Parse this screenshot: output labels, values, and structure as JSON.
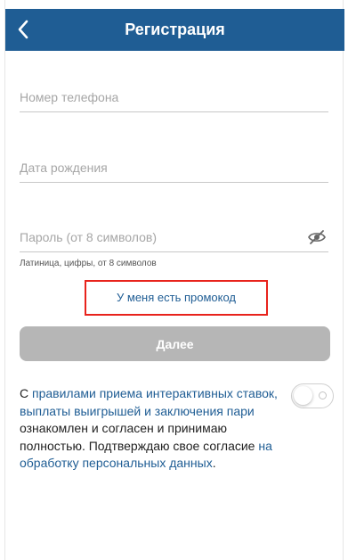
{
  "header": {
    "title": "Регистрация",
    "back_icon": "chevron-left-icon",
    "background": "#1f5d94"
  },
  "form": {
    "phone_placeholder": "Номер телефона",
    "phone_value": "",
    "birth_placeholder": "Дата рождения",
    "birth_value": "",
    "password_placeholder": "Пароль (от 8 символов)",
    "password_value": "",
    "password_visibility_icon": "eye-off-icon",
    "password_hint": "Латиница, цифры, от 8 символов"
  },
  "promo": {
    "label": "У меня есть промокод",
    "highlight_color": "#e8231c"
  },
  "next_button": {
    "label": "Далее",
    "color": "#b6b6b6"
  },
  "agreement": {
    "prefix": "С ",
    "rules_link": "правилами приема интерактивных ставок, выплаты выигрышей и заключения пари",
    "middle": " ознакомлен и согласен и принимаю полностью. Подтверждаю свое согласие ",
    "privacy_link": "на обработку персональных данных",
    "suffix": ".",
    "toggle_on": false,
    "link_color": "#1f5d94"
  }
}
